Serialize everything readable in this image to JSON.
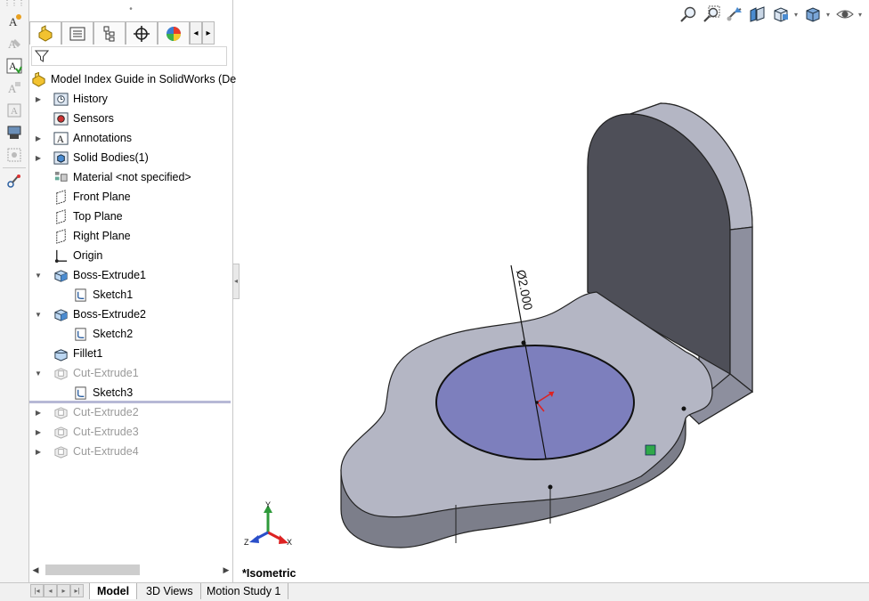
{
  "feature_manager": {
    "tabs": [
      "feature-manager",
      "property-manager",
      "configuration-manager",
      "dimxpert-manager",
      "display-manager"
    ],
    "filter_icon": "filter-icon",
    "root_label": "Model Index Guide in SolidWorks  (De",
    "items": [
      {
        "label": "History",
        "icon": "history-icon",
        "expander": "collapsed"
      },
      {
        "label": "Sensors",
        "icon": "sensors-icon",
        "expander": ""
      },
      {
        "label": "Annotations",
        "icon": "annotations-icon",
        "expander": "collapsed"
      },
      {
        "label": "Solid Bodies(1)",
        "icon": "solid-bodies-icon",
        "expander": "collapsed"
      },
      {
        "label": "Material <not specified>",
        "icon": "material-icon",
        "expander": ""
      },
      {
        "label": "Front Plane",
        "icon": "plane-icon",
        "expander": ""
      },
      {
        "label": "Top Plane",
        "icon": "plane-icon",
        "expander": ""
      },
      {
        "label": "Right Plane",
        "icon": "plane-icon",
        "expander": ""
      },
      {
        "label": "Origin",
        "icon": "origin-icon",
        "expander": ""
      },
      {
        "label": "Boss-Extrude1",
        "icon": "boss-extrude-icon",
        "expander": "expanded"
      },
      {
        "label": "Sketch1",
        "icon": "sketch-icon",
        "expander": "",
        "child": true
      },
      {
        "label": "Boss-Extrude2",
        "icon": "boss-extrude-icon",
        "expander": "expanded"
      },
      {
        "label": "Sketch2",
        "icon": "sketch-icon",
        "expander": "",
        "child": true
      },
      {
        "label": "Fillet1",
        "icon": "fillet-icon",
        "expander": ""
      },
      {
        "label": "Cut-Extrude1",
        "icon": "cut-extrude-icon",
        "expander": "expanded",
        "dim": true
      },
      {
        "label": "Sketch3",
        "icon": "sketch-icon",
        "expander": "",
        "child": true
      },
      {
        "label": "Cut-Extrude2",
        "icon": "cut-extrude-icon",
        "expander": "collapsed",
        "dim": true
      },
      {
        "label": "Cut-Extrude3",
        "icon": "cut-extrude-icon",
        "expander": "collapsed",
        "dim": true
      },
      {
        "label": "Cut-Extrude4",
        "icon": "cut-extrude-icon",
        "expander": "collapsed",
        "dim": true
      }
    ]
  },
  "viewport": {
    "dimension_text": "Ø2.000",
    "view_label": "*Isometric",
    "hud_icons": [
      "zoom-to-fit-icon",
      "zoom-to-area-icon",
      "previous-view-icon",
      "section-view-icon",
      "view-orientation-icon",
      "display-style-icon",
      "hide-show-items-icon"
    ],
    "triad": {
      "x": "X",
      "y": "Y",
      "z": "Z"
    },
    "colors": {
      "body": "#b4b6c4",
      "side": "#7c7e8a",
      "hole": "#7d7fbd",
      "upright_face": "#4e4f58"
    }
  },
  "bottom_tabs": [
    "Model",
    "3D Views",
    "Motion Study 1"
  ],
  "left_toolbar_icons": [
    "smart-dimension-icon",
    "note-icon",
    "spell-check-icon",
    "format-painter-icon",
    "balloon-icon",
    "surface-finish-icon",
    "weld-symbol-icon",
    "datum-icon",
    "model-items-icon"
  ]
}
